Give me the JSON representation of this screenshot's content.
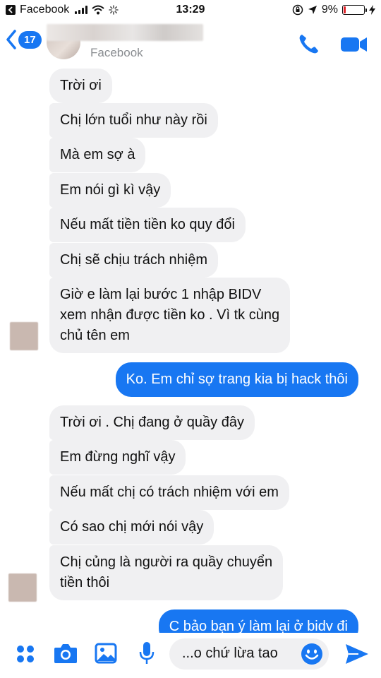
{
  "status_bar": {
    "back_app": "Facebook",
    "time": "13:29",
    "battery_percent": "9%"
  },
  "header": {
    "back_badge": "17",
    "subtitle": "Facebook"
  },
  "messages": [
    {
      "direction": "in",
      "text": "Trời ơi"
    },
    {
      "direction": "in",
      "text": "Chị lớn tuổi như này rồi"
    },
    {
      "direction": "in",
      "text": "Mà em sợ à"
    },
    {
      "direction": "in",
      "text": "Em nói gì kì vậy"
    },
    {
      "direction": "in",
      "text": "Nếu mất tiền tiền ko quy đổi"
    },
    {
      "direction": "in",
      "text": "Chị sẽ chịu trách nhiệm"
    },
    {
      "direction": "in",
      "lines": [
        "Giờ e làm lại bước 1 nhập BIDV",
        "xem nhận được tiền ko . Vì tk cùng",
        "chủ tên em"
      ]
    },
    {
      "direction": "out",
      "text": "Ko. Em chỉ sợ trang kia bị hack thôi"
    },
    {
      "direction": "in",
      "text": "Trời ơi . Chị đang ở quầy đây"
    },
    {
      "direction": "in",
      "text": "Em đừng nghĩ vậy"
    },
    {
      "direction": "in",
      "text": "Nếu mất chị có trách nhiệm với em"
    },
    {
      "direction": "in",
      "text": "Có sao chị mới nói vậy"
    },
    {
      "direction": "in",
      "lines": [
        "Chị củng là người ra quầy chuyển",
        "tiền thôi"
      ]
    },
    {
      "direction": "out",
      "text": "C bảo bạn ý làm lại ở bidv đi"
    }
  ],
  "composer": {
    "text": "...o chứ lừa tao"
  },
  "icons": {
    "back": "chevron-left-icon",
    "call": "phone-icon",
    "video": "video-camera-icon",
    "apps": "four-dots-icon",
    "camera": "camera-icon",
    "gallery": "image-icon",
    "mic": "microphone-icon",
    "emoji": "smiley-icon",
    "send": "send-icon"
  },
  "colors": {
    "accent": "#1877f2",
    "incoming_bubble": "#f0f0f2",
    "battery_low": "#e0242b"
  }
}
